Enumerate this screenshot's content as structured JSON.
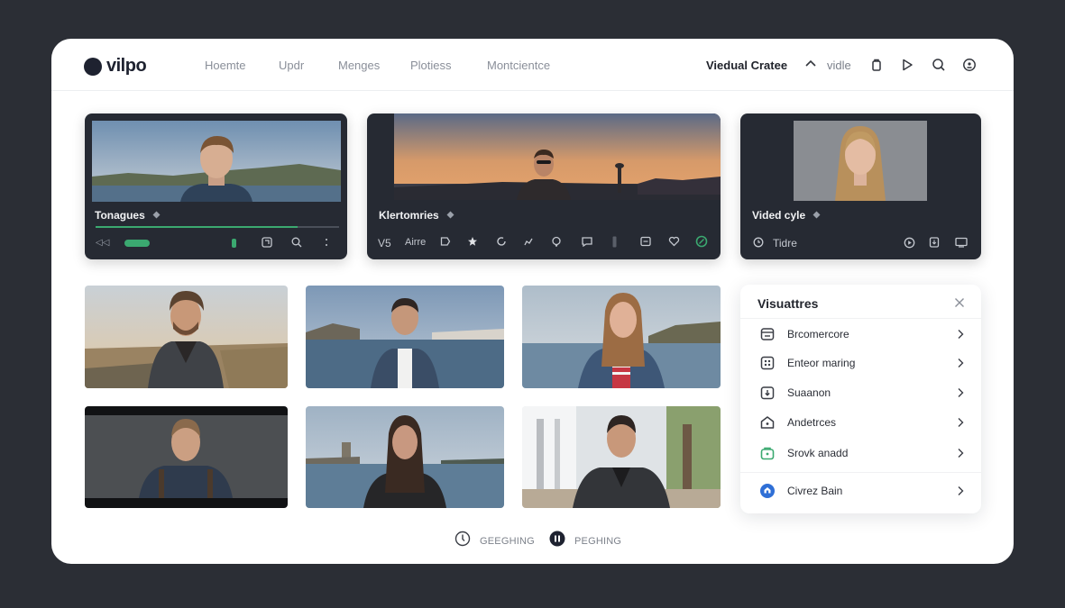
{
  "app": {
    "name": "vilpo"
  },
  "nav": {
    "items": [
      "Hoemte",
      "Updr",
      "Menges",
      "Plotiess",
      "Montcientce"
    ]
  },
  "header": {
    "title": "Viedual Cratee",
    "label": "vidle"
  },
  "cards": [
    {
      "title": "Tonagues"
    },
    {
      "title": "Klertomries",
      "controls": {
        "speed": "V5",
        "mode": "Airre"
      }
    },
    {
      "title": "Vided cyle",
      "controls": {
        "time_label": "Tidre"
      }
    }
  ],
  "panel": {
    "title": "Visuattres",
    "items": [
      {
        "label": "Brcomercore"
      },
      {
        "label": "Enteor maring"
      },
      {
        "label": "Suaanon"
      },
      {
        "label": "Andetrces"
      },
      {
        "label": "Srovk anadd"
      },
      {
        "label": "Civrez Bain"
      }
    ]
  },
  "footer": {
    "buttons": [
      "GEEGHING",
      "PEGHING"
    ]
  },
  "colors": {
    "accent": "#3ba970",
    "brand_dark": "#1e2230",
    "link_blue": "#2f6fd6"
  }
}
